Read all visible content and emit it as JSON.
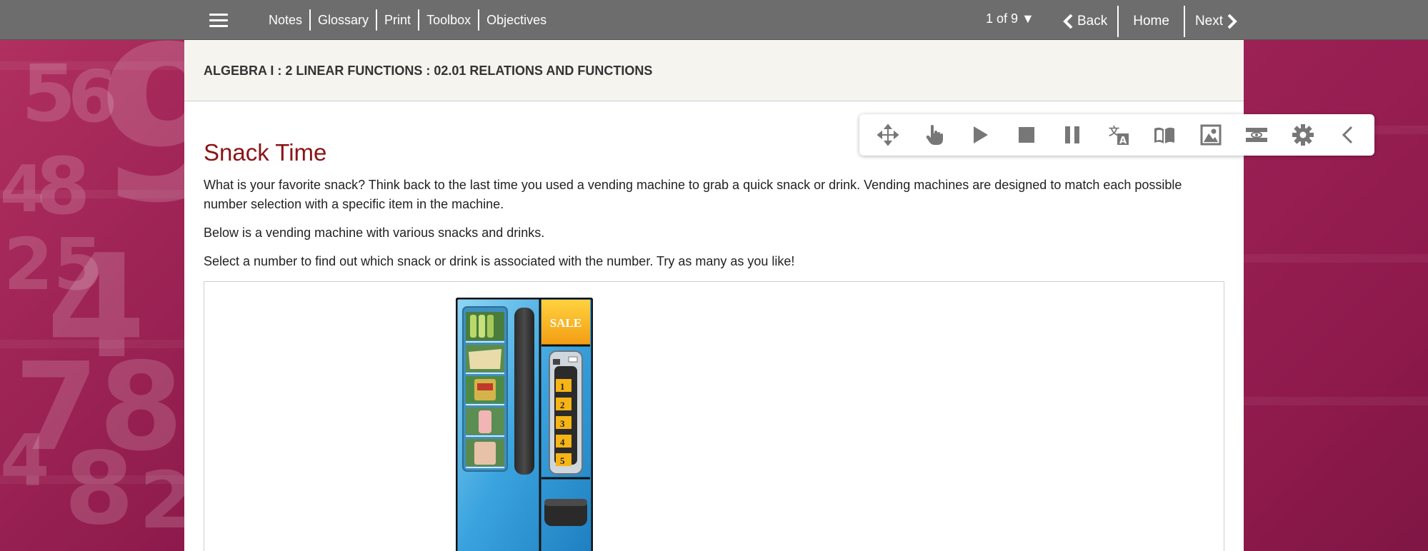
{
  "topbar": {
    "nav": [
      "Notes",
      "Glossary",
      "Print",
      "Toolbox",
      "Objectives"
    ],
    "pager": "1 of 9 ▼",
    "back_label": "Back",
    "home_label": "Home",
    "next_label": "Next"
  },
  "breadcrumb": "ALGEBRA I : 2 LINEAR FUNCTIONS : 02.01 RELATIONS AND FUNCTIONS",
  "lesson": {
    "title": "Snack Time",
    "paragraphs": [
      "What is your favorite snack? Think back to the last time you used a vending machine to grab a quick snack or drink. Vending machines are designed to match each possible number selection with a specific item in the machine.",
      "Below is a vending machine with various snacks and drinks.",
      "Select a number to find out which snack or drink is associated with the number. Try as many as you like!"
    ]
  },
  "toolbar_icons": [
    "move-icon",
    "hand-pointer-icon",
    "play-icon",
    "stop-icon",
    "pause-icon",
    "translate-icon",
    "dictionary-icon",
    "picture-icon",
    "screen-mask-icon",
    "settings-gear-icon",
    "collapse-chevron-icon"
  ],
  "vending_machine": {
    "sale_label": "SALE",
    "buttons": [
      "1",
      "2",
      "3",
      "4",
      "5"
    ]
  },
  "colors": {
    "topbar": "#6d6d6d",
    "title": "#8b1416",
    "background": "#8f1d4f",
    "machine_blue": "#3aa3de",
    "sale_yellow": "#f6b417"
  }
}
